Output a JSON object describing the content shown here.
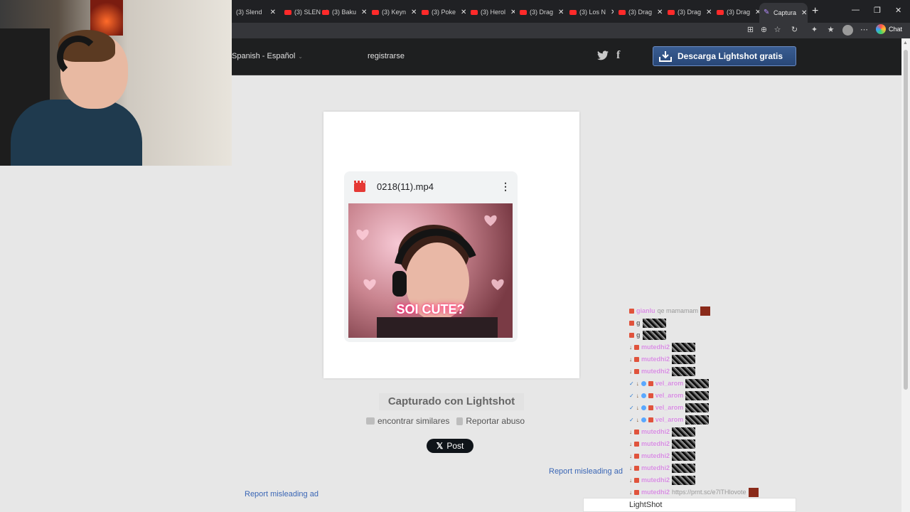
{
  "browser": {
    "tabs": [
      {
        "label": "(3) Slend"
      },
      {
        "label": "(3) SLEN"
      },
      {
        "label": "(3) Baku"
      },
      {
        "label": "(3) Keyn"
      },
      {
        "label": "(3) Poke"
      },
      {
        "label": "(3) Herol"
      },
      {
        "label": "(3) Drag"
      },
      {
        "label": "(3) Los N"
      },
      {
        "label": "(3) Drag"
      },
      {
        "label": "(3) Drag"
      },
      {
        "label": "(3) Drag"
      },
      {
        "label": "Captura"
      }
    ],
    "new_tab": "+",
    "chat_label": "Chat"
  },
  "site_header": {
    "language": "Spanish - Español",
    "register": "registrarse",
    "download_button": "Descarga Lightshot gratis"
  },
  "screenshot": {
    "file_name": "0218(11).mp4",
    "caption": "SOI CUTE?"
  },
  "footer": {
    "captured": "Capturado con Lightshot",
    "find_similar": "encontrar similares",
    "report_abuse": "Reportar abuso",
    "post_button": "Post",
    "report_ad_right": "Report misleading ad",
    "report_ad_left": "Report misleading ad"
  },
  "chat": {
    "rows": [
      {
        "user": "gianlu",
        "msg": "qe mamamam",
        "type": "a"
      },
      {
        "user": "g",
        "msg": "",
        "type": "b"
      },
      {
        "user": "g",
        "msg": "",
        "type": "b"
      },
      {
        "user": "mutedhi2",
        "msg": "",
        "type": "c"
      },
      {
        "user": "mutedhi2",
        "msg": "",
        "type": "c"
      },
      {
        "user": "mutedhi2",
        "msg": "",
        "type": "c"
      },
      {
        "user": "vel_arom",
        "msg": "",
        "type": "d"
      },
      {
        "user": "vel_arom",
        "msg": "",
        "type": "d"
      },
      {
        "user": "vel_arom",
        "msg": "",
        "type": "d"
      },
      {
        "user": "vel_arom",
        "msg": "",
        "type": "d"
      },
      {
        "user": "mutedhi2",
        "msg": "",
        "type": "c"
      },
      {
        "user": "mutedhi2",
        "msg": "",
        "type": "c"
      },
      {
        "user": "mutedhi2",
        "msg": "",
        "type": "c"
      },
      {
        "user": "mutedhi2",
        "msg": "",
        "type": "c"
      },
      {
        "user": "mutedhi2",
        "msg": "",
        "type": "c"
      },
      {
        "user": "mutedhi2",
        "msg": "https://prnt.sc/e7lTHlovote",
        "type": "c"
      }
    ],
    "ad_text": "LightShot"
  }
}
